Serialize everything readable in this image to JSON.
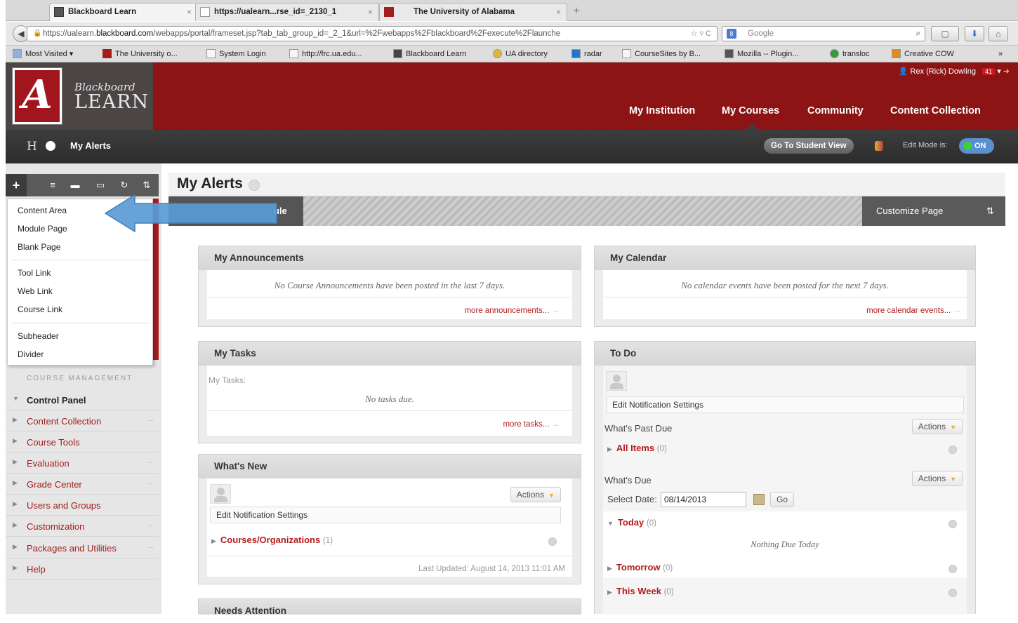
{
  "browser": {
    "tabs": [
      {
        "label": "Blackboard Learn",
        "close": "×"
      },
      {
        "label": "https://ualearn...rse_id=_2130_1",
        "close": "×"
      },
      {
        "label": "The University of Alabama",
        "close": "×"
      }
    ],
    "new_tab": "+",
    "back": "◀",
    "url_prefix": "https://ualearn.",
    "url_domain": "blackboard.com",
    "url_rest": "/webapps/portal/frameset.jsp?tab_tab_group_id=_2_1&url=%2Fwebapps%2Fblackboard%2Fexecute%2Flaunche",
    "url_icons": "☆ ▿ C",
    "search_engine_icon": "8",
    "search_placeholder": "Google",
    "search_glyph": "⌕",
    "nav_buttons": [
      "▢",
      "⬇",
      "⌂"
    ],
    "bookmarks": [
      "Most Visited ▾",
      "The University o...",
      "System Login",
      "http://frc.ua.edu...",
      "Blackboard Learn",
      "UA directory",
      "radar",
      "CourseSites by B...",
      "Mozilla -- Plugin...",
      "transloc",
      "Creative COW"
    ],
    "bookmarks_overflow": "»"
  },
  "header": {
    "logo_letter": "A",
    "logo_line1": "Blackboard",
    "logo_line2": "LEARN",
    "user_name": "Rex (Rick) Dowling",
    "user_badge": "41",
    "nav": [
      "My Institution",
      "My Courses",
      "Community",
      "Content Collection"
    ]
  },
  "toolbar": {
    "home_label": "H",
    "breadcrumb": "My Alerts",
    "student_view": "Go To Student View",
    "edit_mode_label": "Edit Mode is:",
    "edit_mode_value": "ON"
  },
  "left": {
    "tools": [
      "+",
      "≡",
      "▬",
      "▭",
      "↻",
      "⇅"
    ],
    "add_menu": [
      "Content Area",
      "Module Page",
      "Blank Page",
      "Tool Link",
      "Web Link",
      "Course Link",
      "Subheader",
      "Divider"
    ],
    "course_management": "COURSE MANAGEMENT",
    "control_panel": "Control Panel",
    "items": [
      "Content Collection",
      "Course Tools",
      "Evaluation",
      "Grade Center",
      "Users and Groups",
      "Customization",
      "Packages and Utilities",
      "Help"
    ],
    "item_arrow": "→"
  },
  "main": {
    "title": "My Alerts",
    "module_tab": "ule",
    "customize": "Customize Page",
    "sort_glyph": "⇅",
    "announcements": {
      "title": "My Announcements",
      "empty": "No Course Announcements have been posted in the last 7 days.",
      "more": "more announcements..."
    },
    "calendar": {
      "title": "My Calendar",
      "empty": "No calendar events have been posted for the next 7 days.",
      "more": "more calendar events..."
    },
    "tasks": {
      "title": "My Tasks",
      "label": "My Tasks:",
      "empty": "No tasks due.",
      "more": "more tasks..."
    },
    "whats_new": {
      "title": "What's New",
      "actions": "Actions",
      "notif": "Edit Notification Settings",
      "courses_link": "Courses/Organizations",
      "courses_count": "(1)",
      "updated": "Last Updated: August 14, 2013 11:01 AM"
    },
    "needs_attention": {
      "title": "Needs Attention"
    },
    "todo": {
      "title": "To Do",
      "notif": "Edit Notification Settings",
      "past_due": "What's Past Due",
      "actions": "Actions",
      "all_items": "All Items",
      "all_items_count": "(0)",
      "whats_due": "What's Due",
      "select_date_label": "Select Date:",
      "date_value": "08/14/2013",
      "go": "Go",
      "today": "Today",
      "today_count": "(0)",
      "nothing_today": "Nothing Due Today",
      "tomorrow": "Tomorrow",
      "tomorrow_count": "(0)",
      "this_week": "This Week",
      "this_week_count": "(0)"
    }
  },
  "colors": {
    "accent": "#a31d1d",
    "header_red": "#8d1414",
    "callout": "#5b9bd5"
  }
}
